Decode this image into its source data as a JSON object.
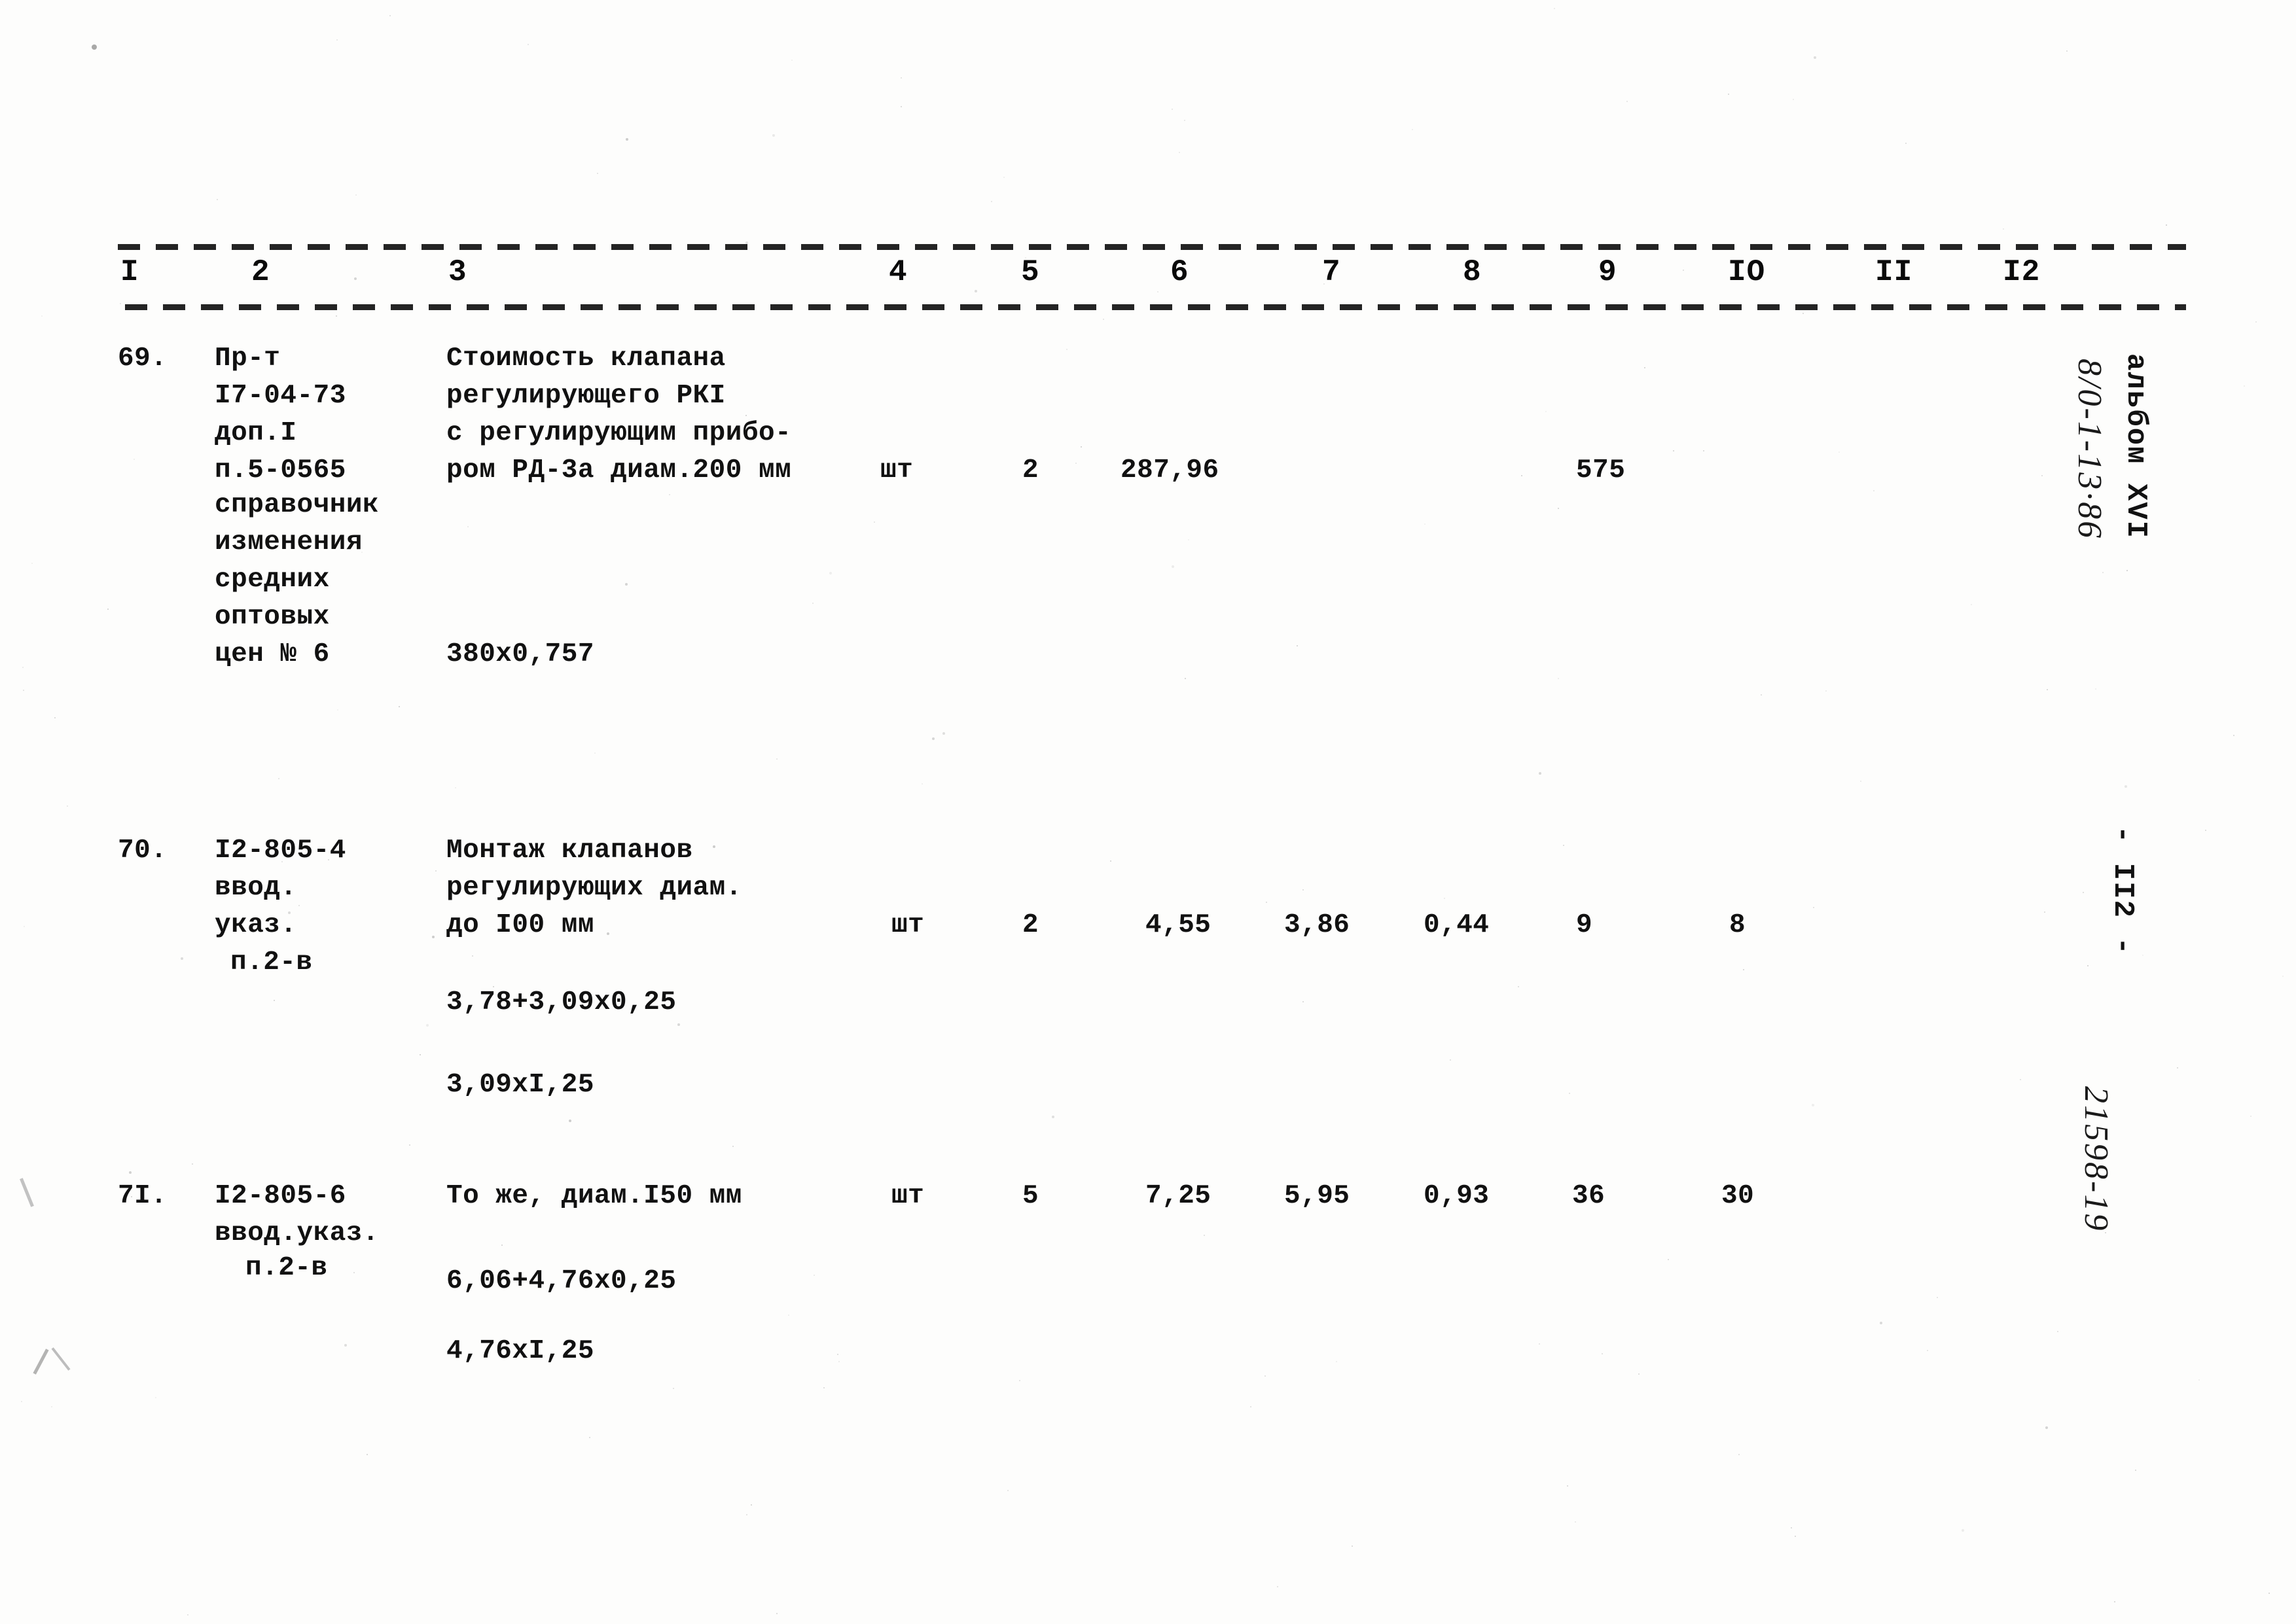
{
  "document": {
    "kind": "scanned-estimate-table",
    "album_label": "альбом XVI",
    "page_number_label": "- II2 -",
    "handwritten_code_top": "8/0-1-13·86",
    "handwritten_code_bottom": "21598-19"
  },
  "table": {
    "column_headers": [
      "I",
      "2",
      "3",
      "4",
      "5",
      "6",
      "7",
      "8",
      "9",
      "IO",
      "II",
      "I2"
    ],
    "rows": [
      {
        "no": "69.",
        "code_lines": [
          "Пр-т",
          "I7-04-73",
          "доп.I",
          "п.5-0565",
          "справочник",
          "изменения",
          "средних",
          "оптовых",
          "цен № 6"
        ],
        "description_lines": [
          "Стоимость клапана",
          "регулирующего РКI",
          "с регулирующим прибо-",
          "ром РД-3а диам.200 мм"
        ],
        "calc_lines": [
          "380x0,757"
        ],
        "unit": "шт",
        "c5": "2",
        "c6": "287,96",
        "c7": "",
        "c8": "",
        "c9": "575",
        "c10": "",
        "c11": "",
        "c12": ""
      },
      {
        "no": "70.",
        "code_lines": [
          "I2-805-4",
          "ввод.",
          "указ.",
          "п.2-в"
        ],
        "description_lines": [
          "Монтаж клапанов",
          "регулирующих диам.",
          "до I00 мм"
        ],
        "calc_lines": [
          "3,78+3,09x0,25",
          "3,09xI,25"
        ],
        "unit": "шт",
        "c5": "2",
        "c6": "4,55",
        "c7": "3,86",
        "c8": "0,44",
        "c9": "9",
        "c10": "8",
        "c11": "",
        "c12": ""
      },
      {
        "no": "7I.",
        "code_lines": [
          "I2-805-6",
          "ввод.указ.",
          "п.2-в"
        ],
        "description_lines": [
          "То же, диам.I50 мм"
        ],
        "calc_lines": [
          "6,06+4,76x0,25",
          "4,76xI,25"
        ],
        "unit": "шт",
        "c5": "5",
        "c6": "7,25",
        "c7": "5,95",
        "c8": "0,93",
        "c9": "36",
        "c10": "30",
        "c11": "",
        "c12": ""
      }
    ]
  }
}
